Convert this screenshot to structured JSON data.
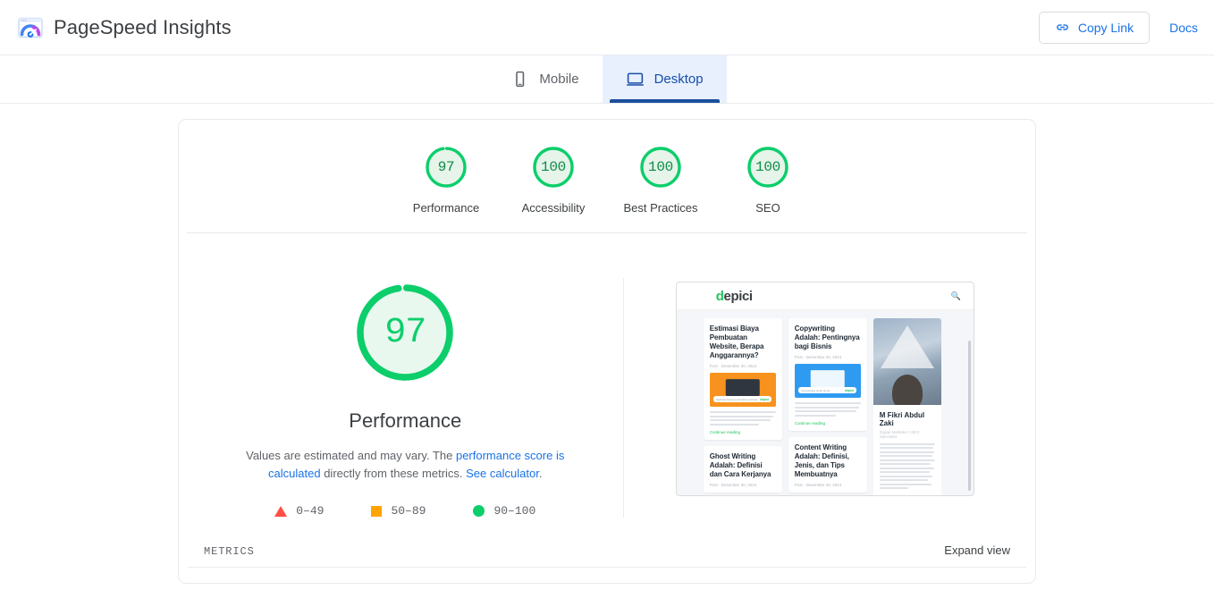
{
  "header": {
    "title": "PageSpeed Insights",
    "logo_icon": "pagespeed-gauge-icon",
    "copy_link_label": "Copy Link",
    "copy_link_icon": "link-icon",
    "docs_label": "Docs"
  },
  "tabs": [
    {
      "label": "Mobile",
      "icon": "mobile-phone-icon",
      "active": false
    },
    {
      "label": "Desktop",
      "icon": "desktop-monitor-icon",
      "active": true
    }
  ],
  "summary_scores": [
    {
      "label": "Performance",
      "value": "97",
      "percent": 97,
      "color": "#0cce6b"
    },
    {
      "label": "Accessibility",
      "value": "100",
      "percent": 100,
      "color": "#0cce6b"
    },
    {
      "label": "Best Practices",
      "value": "100",
      "percent": 100,
      "color": "#0cce6b"
    },
    {
      "label": "SEO",
      "value": "100",
      "percent": 100,
      "color": "#0cce6b"
    }
  ],
  "performance": {
    "score": "97",
    "percent": 97,
    "title": "Performance",
    "description_prefix": "Values are estimated and may vary. The ",
    "link_score_calculated": "performance score is calculated",
    "description_middle": " directly from these metrics. ",
    "link_calculator": "See calculator",
    "description_suffix": "."
  },
  "legend": [
    {
      "range": "0–49",
      "shape": "triangle",
      "color": "#ff4e42"
    },
    {
      "range": "50–89",
      "shape": "square",
      "color": "#ffa400"
    },
    {
      "range": "90–100",
      "shape": "circle",
      "color": "#0cce6b"
    }
  ],
  "thumbnail": {
    "site_logo_first": "d",
    "site_logo_rest": "epici",
    "search_icon": "search-icon",
    "cards": [
      {
        "title": "Estimasi Biaya Pembuatan Website, Berapa Anggarannya?",
        "meta": "Post · Desember 30, 2024",
        "image_style": "orange",
        "image_caption": "Estimasi biaya pembuatan website",
        "image_badge": "depici",
        "read_more": "Continue reading"
      },
      {
        "title": "Copywriting Adalah: Pentingnya bagi Bisnis",
        "meta": "Post · Desember 30, 2024",
        "image_style": "blue",
        "image_caption": "Copywriting untuk bisnis",
        "image_badge": "depici",
        "read_more": "Continue reading"
      },
      {
        "title": "Ghost Writing Adalah: Definisi dan Cara Kerjanya",
        "meta": "Post · Desember 30, 2024"
      },
      {
        "title": "Content Writing Adalah: Definisi, Jenis, dan Tips Membuatnya",
        "meta": "Post · Desember 30, 2024"
      }
    ],
    "author": {
      "name": "M Fikri Abdul Zaki",
      "role": "Digital Marketer | SEO Specialist"
    }
  },
  "footer": {
    "metrics_label": "METRICS",
    "expand_view_label": "Expand view"
  }
}
